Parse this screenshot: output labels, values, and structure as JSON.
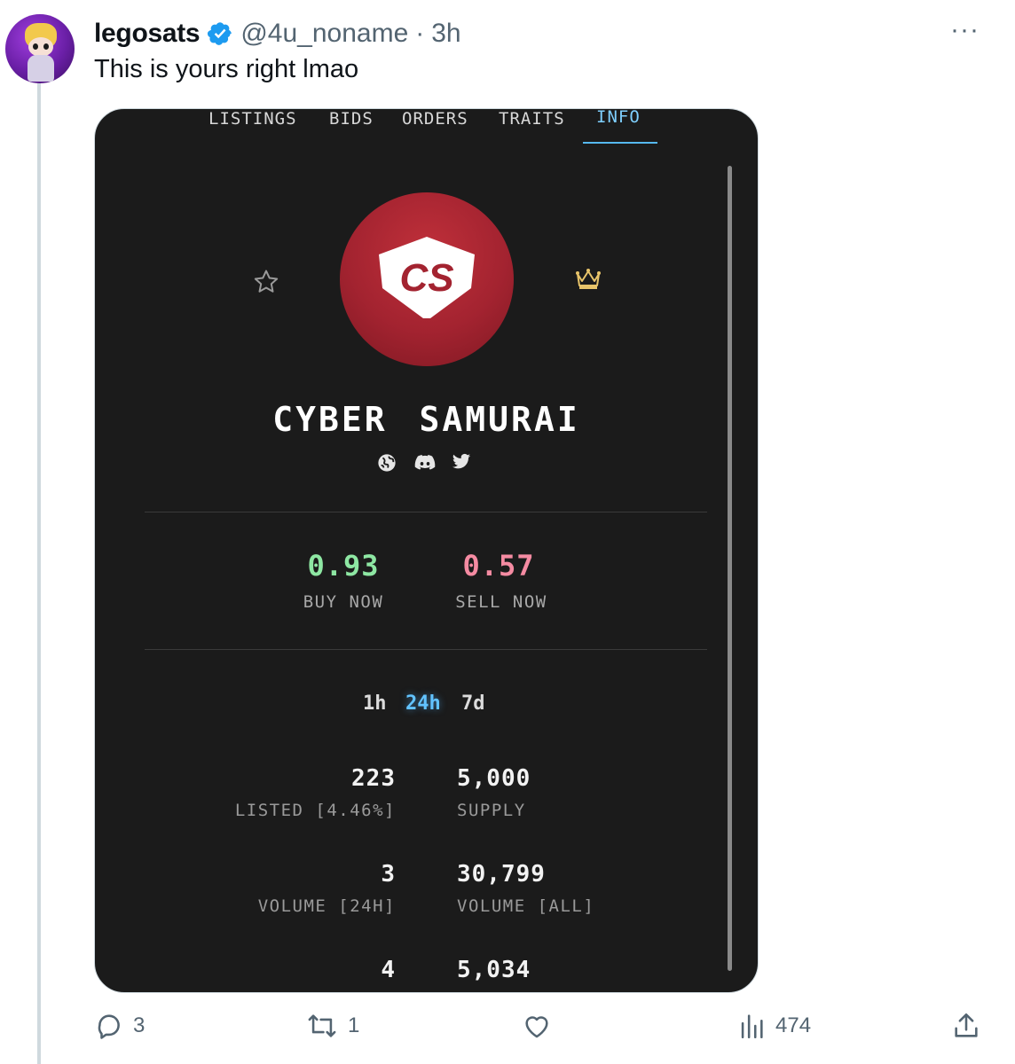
{
  "tweet": {
    "author_name": "legosats",
    "handle": "@4u_noname",
    "separator": "·",
    "time": "3h",
    "more": "···",
    "text": "This is yours right lmao"
  },
  "embedded": {
    "tabs": [
      "LISTINGS",
      "BIDS",
      "ORDERS",
      "TRAITS",
      "INFO"
    ],
    "active_tab": "INFO",
    "logo_text": "CS",
    "collection_name": "CYBER SAMURAI",
    "socials": [
      "globe-icon",
      "discord-icon",
      "twitter-icon"
    ],
    "buy_now": {
      "value": "0.93",
      "label": "BUY NOW",
      "color": "#8ee7a3"
    },
    "sell_now": {
      "value": "0.57",
      "label": "SELL NOW",
      "color": "#f58ba2"
    },
    "ranges": [
      "1h",
      "24h",
      "7d"
    ],
    "active_range": "24h",
    "stats": [
      {
        "left_value": "223",
        "left_label": "LISTED [4.46%]",
        "right_value": "5,000",
        "right_label": "SUPPLY"
      },
      {
        "left_value": "3",
        "left_label": "VOLUME [24H]",
        "right_value": "30,799",
        "right_label": "VOLUME [ALL]"
      },
      {
        "left_value": "4",
        "left_label": "",
        "right_value": "5,034",
        "right_label": ""
      }
    ]
  },
  "actions": {
    "replies": "3",
    "reposts": "1",
    "likes": "",
    "views": "474"
  },
  "colors": {
    "accent": "#1d9bf0",
    "card_bg": "#1b1b1b",
    "info_tab": "#7fd0ff"
  }
}
